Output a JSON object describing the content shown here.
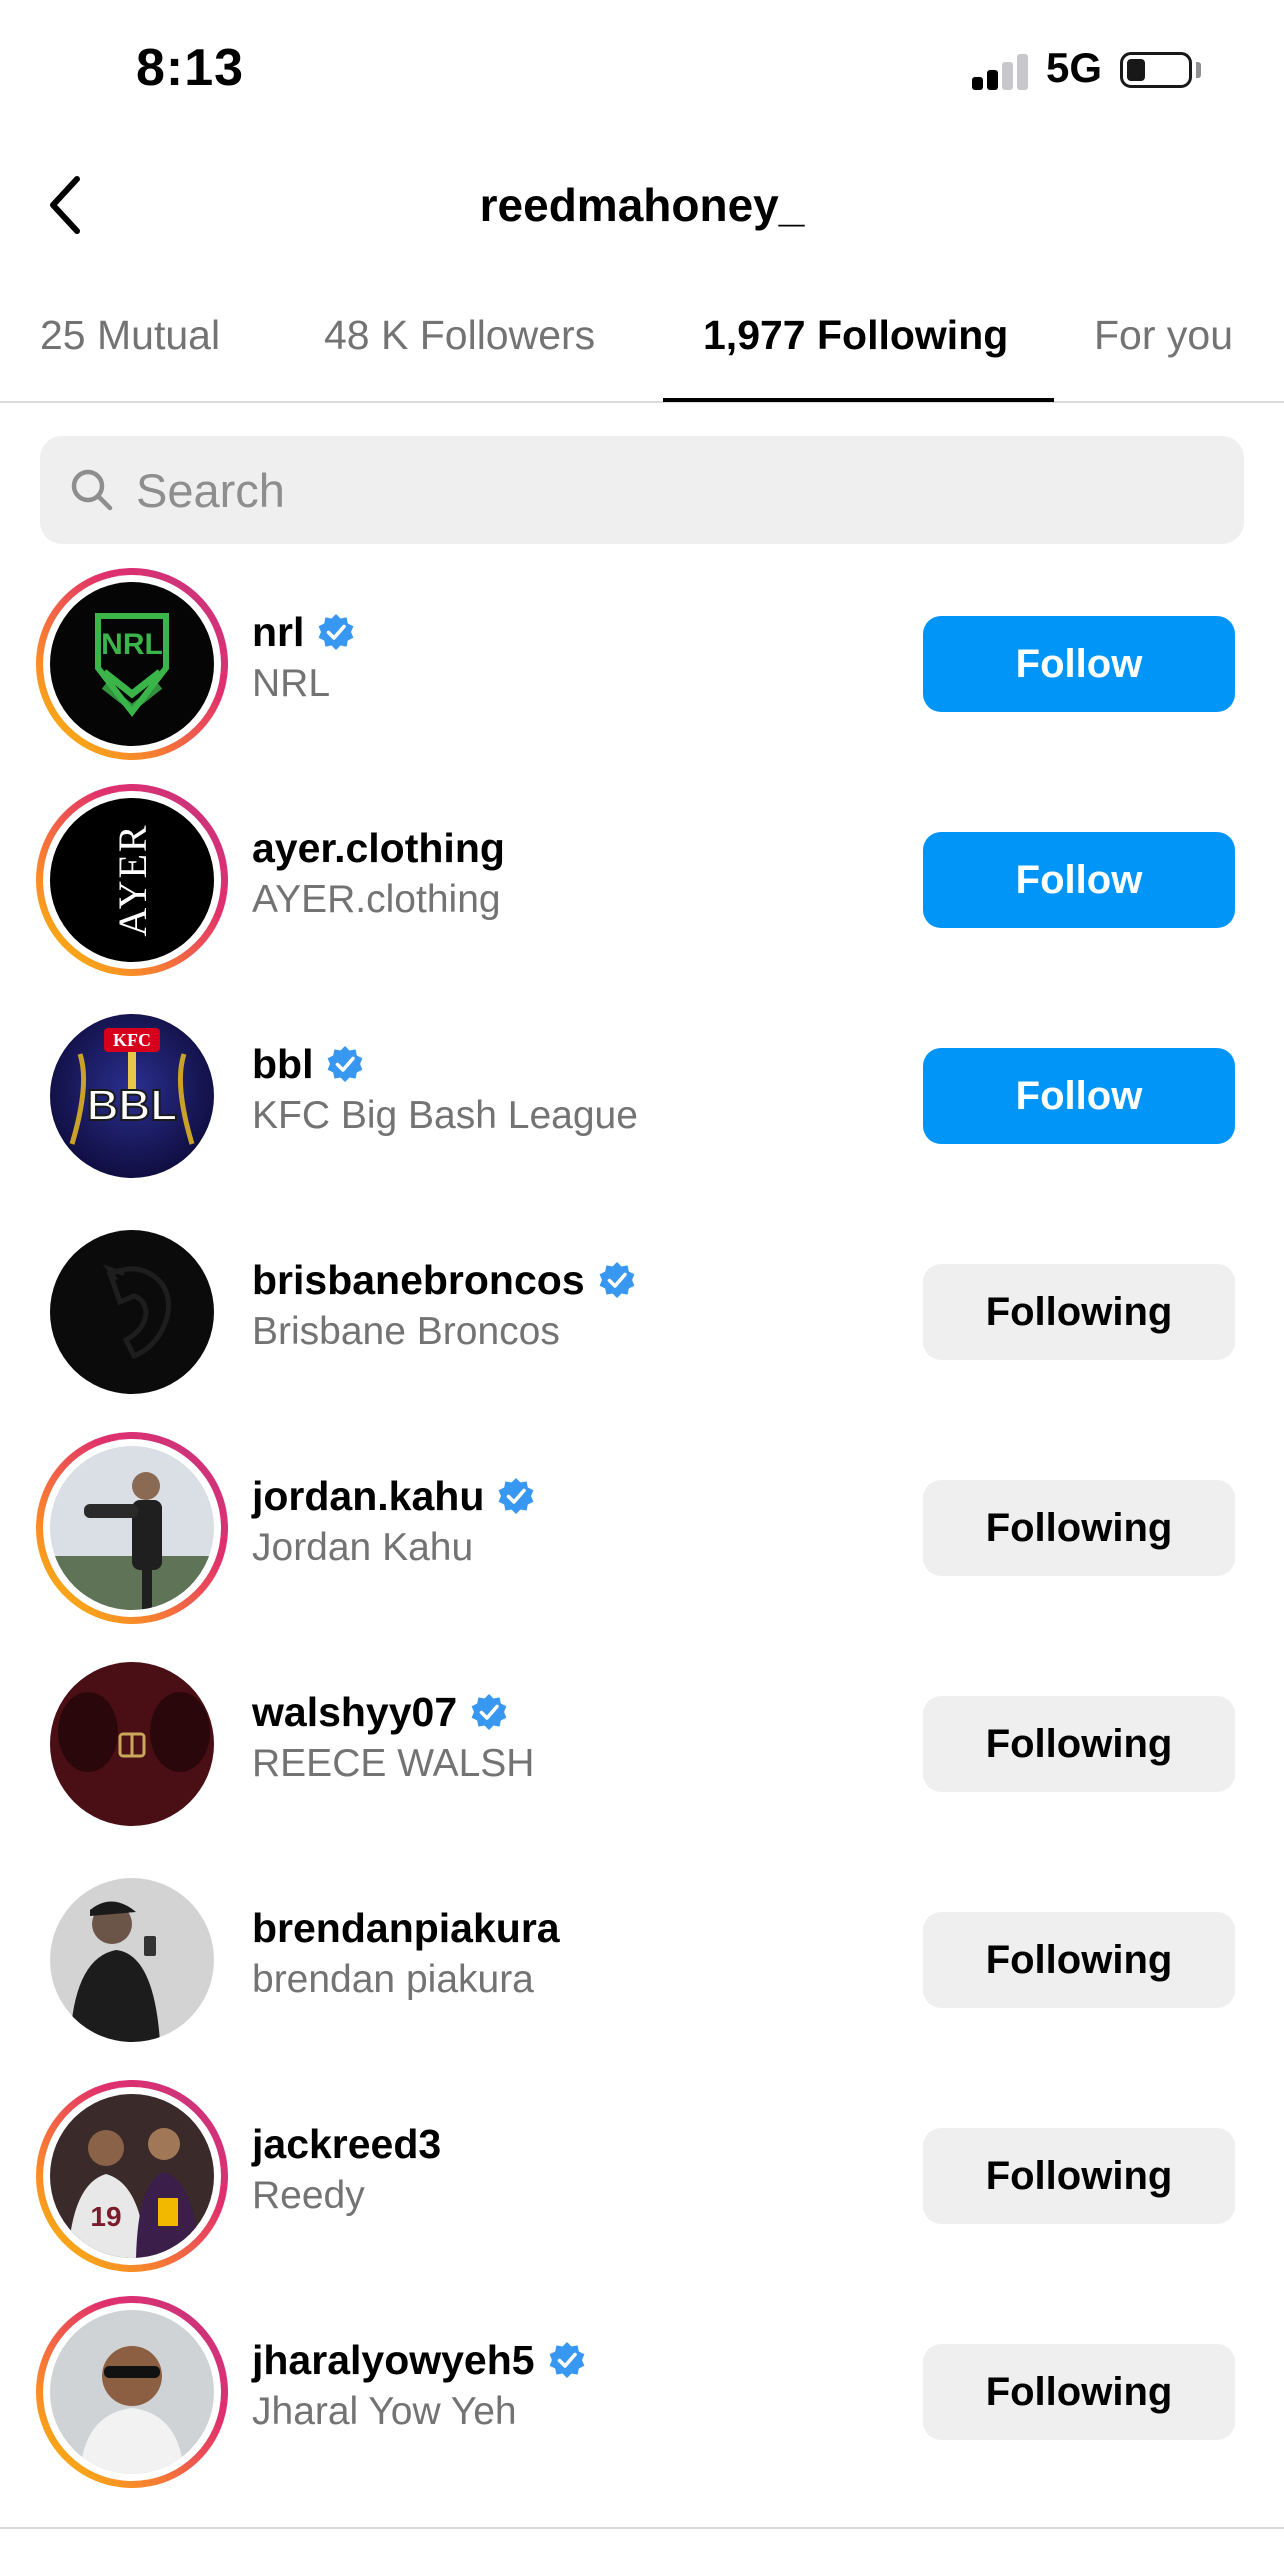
{
  "status_bar": {
    "time": "8:13",
    "network": "5G"
  },
  "header": {
    "title": "reedmahoney_"
  },
  "tabs": [
    {
      "label": "25 Mutual"
    },
    {
      "label": "48 K Followers"
    },
    {
      "label": "1,977 Following"
    },
    {
      "label": "For you"
    }
  ],
  "search": {
    "placeholder": "Search"
  },
  "users": [
    {
      "username": "nrl",
      "full_name": "NRL",
      "verified": true,
      "button": "Follow",
      "avatar_text": "NRL"
    },
    {
      "username": "ayer.clothing",
      "full_name": "AYER.clothing",
      "verified": false,
      "button": "Follow",
      "avatar_text": "AYER"
    },
    {
      "username": "bbl",
      "full_name": "KFC Big Bash League",
      "verified": true,
      "button": "Follow",
      "avatar_text": "BBL",
      "avatar_text_top": "KFC"
    },
    {
      "username": "brisbanebroncos",
      "full_name": "Brisbane Broncos",
      "verified": true,
      "button": "Following"
    },
    {
      "username": "jordan.kahu",
      "full_name": "Jordan Kahu",
      "verified": true,
      "button": "Following"
    },
    {
      "username": "walshyy07",
      "full_name": "REECE WALSH",
      "verified": true,
      "button": "Following"
    },
    {
      "username": "brendanpiakura",
      "full_name": "brendan piakura",
      "verified": false,
      "button": "Following"
    },
    {
      "username": "jackreed3",
      "full_name": "Reedy",
      "verified": false,
      "button": "Following",
      "avatar_text": "19"
    },
    {
      "username": "jharalyowyeh5",
      "full_name": "Jharal Yow Yeh",
      "verified": true,
      "button": "Following"
    }
  ],
  "colors": {
    "accent": "#0095f6",
    "verified": "#3897f0",
    "secondary_text": "#737373"
  }
}
